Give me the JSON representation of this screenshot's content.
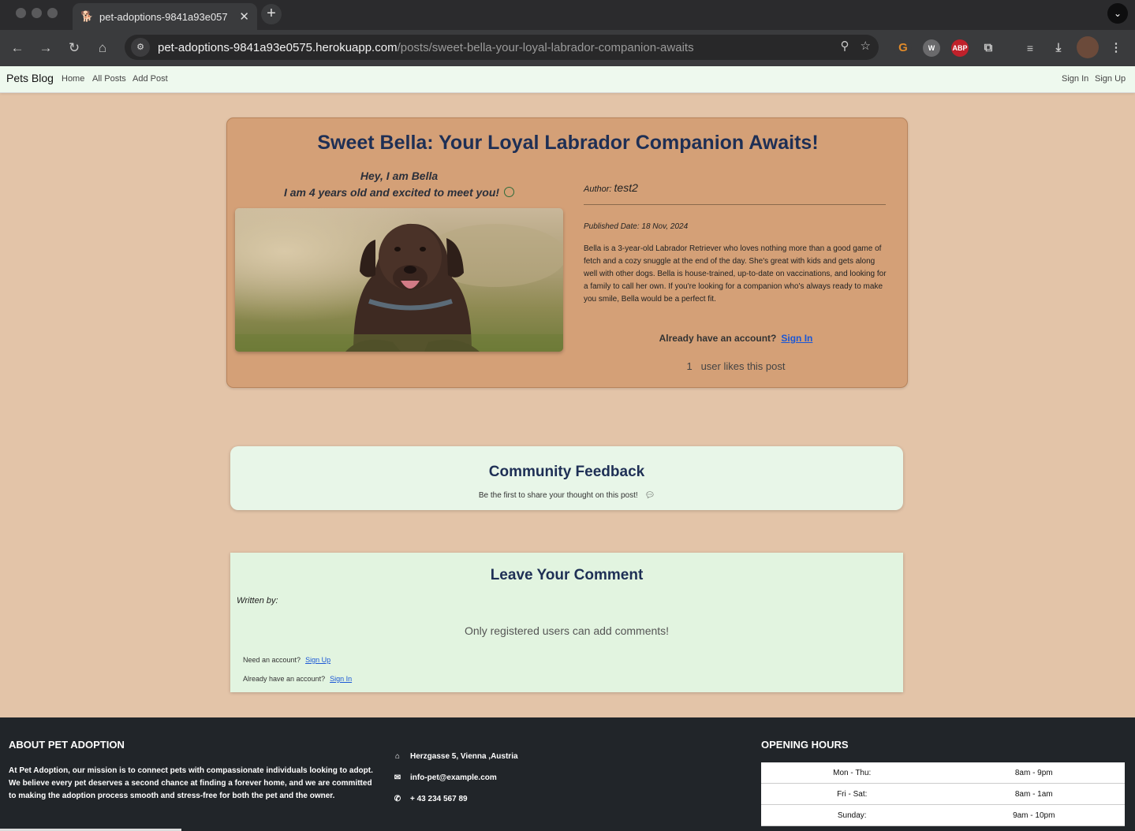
{
  "browser": {
    "tab_title": "pet-adoptions-9841a93e057",
    "url_host": "pet-adoptions-9841a93e0575.herokuapp.com",
    "url_path": "/posts/sweet-bella-your-loyal-labrador-companion-awaits",
    "ext_abp": "ABP"
  },
  "nav": {
    "brand": "Pets Blog",
    "links": [
      "Home",
      "All Posts",
      "Add Post"
    ],
    "sign_in": "Sign In",
    "sign_up": "Sign Up"
  },
  "post": {
    "title": "Sweet Bella: Your Loyal Labrador Companion Awaits!",
    "hey_line1": "Hey, I am Bella",
    "hey_line2": "I am 4 years old and excited to meet you!",
    "author_label": "Author:",
    "author": "test2",
    "published": "Published Date: 18 Nov, 2024",
    "description": "Bella is a 3-year-old Labrador Retriever who loves nothing more than a good game of fetch and a cozy snuggle at the end of the day. She's great with kids and gets along well with other dogs. Bella is house-trained, up-to-date on vaccinations, and looking for a family to call her own. If you're looking for a companion who's always ready to make you smile, Bella would be a perfect fit.",
    "already_text": "Already have an account?",
    "sign_in_link": "Sign In",
    "likes_count": "1",
    "likes_text": "user likes this post"
  },
  "feedback": {
    "title": "Community Feedback",
    "subtitle": "Be the first to share your thought on this post!"
  },
  "comment": {
    "title": "Leave Your Comment",
    "written_by": "Written by:",
    "only_registered": "Only registered users can add comments!",
    "need_account": "Need an account?",
    "sign_up_link": "Sign Up",
    "have_account": "Already have an account?",
    "sign_in_link": "Sign In"
  },
  "footer": {
    "about_title": "ABOUT PET ADOPTION",
    "about_text": "At Pet Adoption, our mission is to connect pets with compassionate individuals looking to adopt. We believe every pet deserves a second chance at finding a forever home, and we are committed to making the adoption process smooth and stress-free for both the pet and the owner.",
    "address": "Herzgasse 5, Vienna ,Austria",
    "email": "info-pet@example.com",
    "phone": "+ 43 234 567 89",
    "hours_title": "OPENING HOURS",
    "hours": [
      {
        "day": "Mon - Thu:",
        "time": "8am - 9pm"
      },
      {
        "day": "Fri - Sat:",
        "time": "8am - 1am"
      },
      {
        "day": "Sunday:",
        "time": "9am - 10pm"
      }
    ]
  },
  "colors": {
    "page_bg": "#e3c4a8",
    "card_bg": "#d4a077",
    "title_navy": "#1e2f55",
    "link_blue": "#1a57d6",
    "footer_bg": "#212529"
  }
}
